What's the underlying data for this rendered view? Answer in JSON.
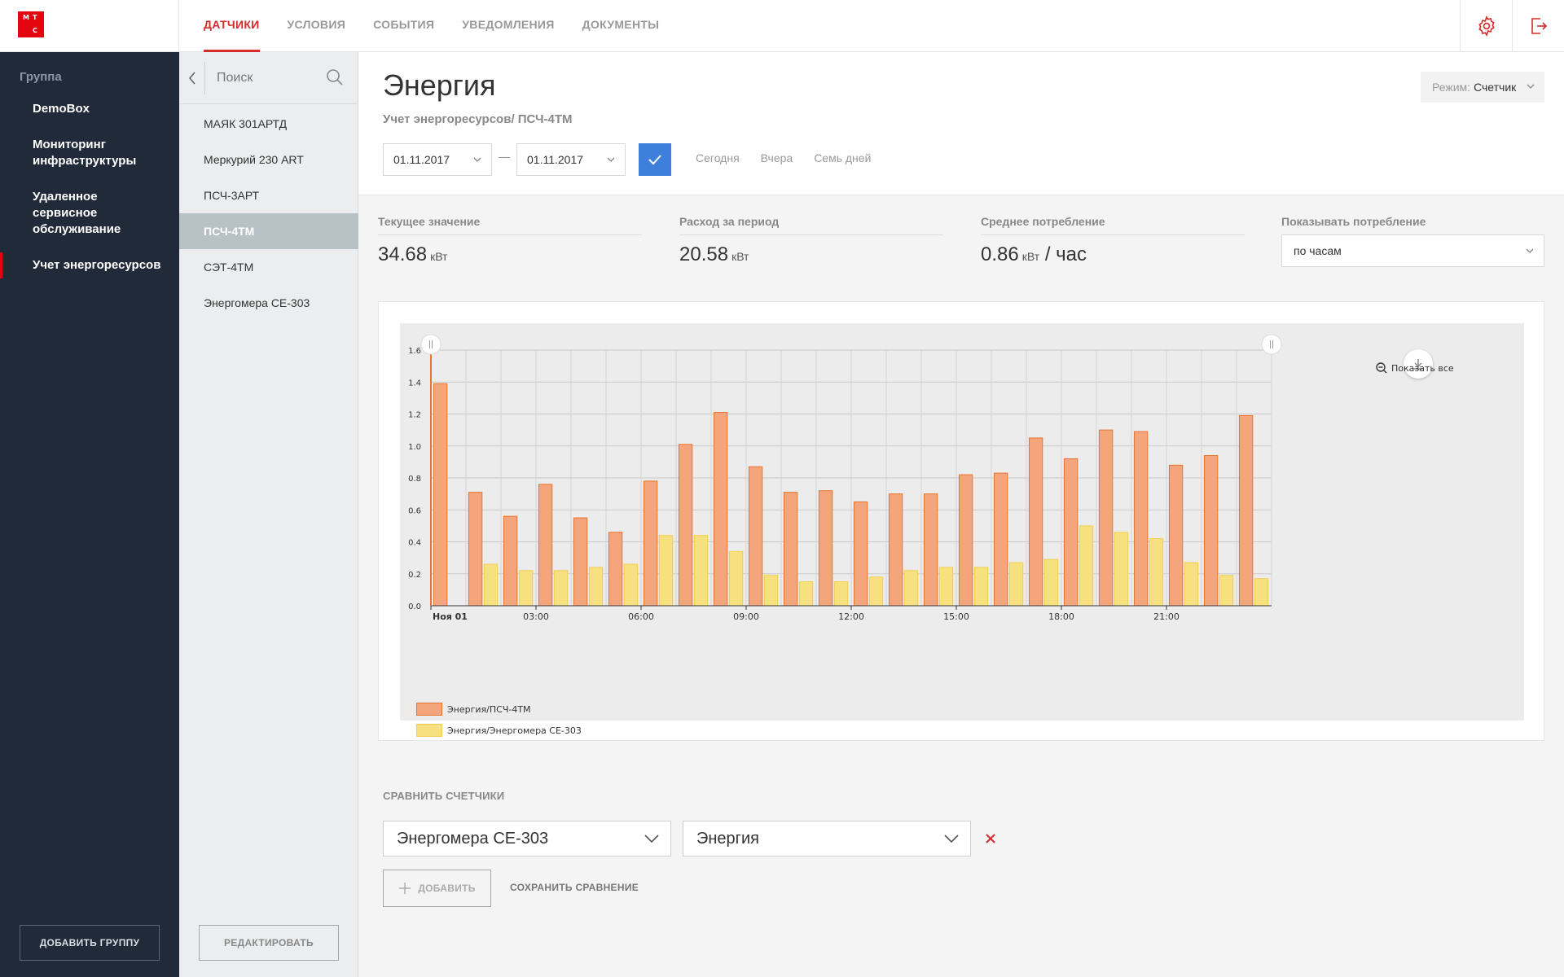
{
  "app": {
    "logo_letters": [
      "М",
      "Т",
      "С"
    ],
    "brand_color": "#e30611"
  },
  "nav": {
    "tabs": [
      {
        "label": "ДАТЧИКИ",
        "active": true
      },
      {
        "label": "УСЛОВИЯ",
        "active": false
      },
      {
        "label": "СОБЫТИЯ",
        "active": false
      },
      {
        "label": "УВЕДОМЛЕНИЯ",
        "active": false
      },
      {
        "label": "ДОКУМЕНТЫ",
        "active": false
      }
    ],
    "icons": [
      "gear-icon",
      "logout-icon"
    ]
  },
  "sidebar": {
    "group_label": "Группа",
    "items": [
      {
        "label": "DemoBox",
        "active": false
      },
      {
        "label": "Мониторинг инфраструктуры",
        "active": false
      },
      {
        "label": "Удаленное сервисное обслуживание",
        "active": false
      },
      {
        "label": "Учет энергоресурсов",
        "active": true
      }
    ],
    "add_group_label": "ДОБАВИТЬ ГРУППУ"
  },
  "sensors": {
    "search_placeholder": "Поиск",
    "items": [
      {
        "label": "МАЯК 301АРТД",
        "active": false
      },
      {
        "label": "Меркурий 230 ART",
        "active": false
      },
      {
        "label": "ПСЧ-3АРТ",
        "active": false
      },
      {
        "label": "ПСЧ-4ТМ",
        "active": true
      },
      {
        "label": "СЭТ-4ТМ",
        "active": false
      },
      {
        "label": "Энергомера СЕ-303",
        "active": false
      }
    ],
    "edit_label": "РЕДАКТИРОВАТЬ"
  },
  "main": {
    "title": "Энергия",
    "subtitle": "Учет энергоресурсов/ ПСЧ-4ТМ",
    "mode": {
      "prefix": "Режим:",
      "value": "Счетчик"
    },
    "date_from": "01.11.2017",
    "date_to": "01.11.2017",
    "date_separator": "—",
    "quick_ranges": [
      "Сегодня",
      "Вчера",
      "Семь дней"
    ],
    "stats": [
      {
        "label": "Текущее значение",
        "value": "34.68",
        "unit": "кВт",
        "suffix": ""
      },
      {
        "label": "Расход за период",
        "value": "20.58",
        "unit": "кВт",
        "suffix": ""
      },
      {
        "label": "Среднее потребление",
        "value": "0.86",
        "unit": "кВт",
        "suffix": "/ час"
      }
    ],
    "consumption": {
      "label": "Показывать потребление",
      "value": "по часам"
    },
    "compare": {
      "label": "СРАВНИТЬ СЧЕТЧИКИ",
      "meter": "Энергомера СЕ-303",
      "metric": "Энергия",
      "add_label": "ДОБАВИТЬ",
      "save_label": "СОХРАНИТЬ СРАВНЕНИЕ"
    }
  },
  "chart_data": {
    "type": "bar",
    "title": "",
    "xlabel": "",
    "ylabel": "",
    "ylim": [
      0,
      1.6
    ],
    "yticks": [
      "0.0",
      "0.2",
      "0.4",
      "0.6",
      "0.8",
      "1.0",
      "1.2",
      "1.4",
      "1.6"
    ],
    "x_tick_labels": [
      {
        "hour": 0,
        "label": "Ноя 01",
        "bold": true
      },
      {
        "hour": 3,
        "label": "03:00",
        "bold": false
      },
      {
        "hour": 6,
        "label": "06:00",
        "bold": false
      },
      {
        "hour": 9,
        "label": "09:00",
        "bold": false
      },
      {
        "hour": 12,
        "label": "12:00",
        "bold": false
      },
      {
        "hour": 15,
        "label": "15:00",
        "bold": false
      },
      {
        "hour": 18,
        "label": "18:00",
        "bold": false
      },
      {
        "hour": 21,
        "label": "21:00",
        "bold": false
      }
    ],
    "hours": [
      0,
      1,
      2,
      3,
      4,
      5,
      6,
      7,
      8,
      9,
      10,
      11,
      12,
      13,
      14,
      15,
      16,
      17,
      18,
      19,
      20,
      21,
      22,
      23
    ],
    "grid": true,
    "legend_position": "bottom-left",
    "show_all_label": "Показать все",
    "series": [
      {
        "name": "Энергия/ПСЧ-4ТМ",
        "color": "#f4a57b",
        "stroke": "#e8742f",
        "values": [
          1.39,
          0.71,
          0.56,
          0.76,
          0.55,
          0.46,
          0.78,
          1.01,
          1.21,
          0.87,
          0.71,
          0.72,
          0.65,
          0.7,
          0.7,
          0.82,
          0.83,
          1.05,
          0.92,
          1.1,
          1.09,
          0.88,
          0.94,
          1.19
        ]
      },
      {
        "name": "Энергия/Энергомера СЕ-303",
        "color": "#f7e07f",
        "stroke": "#f0cf52",
        "values": [
          0,
          0.26,
          0.22,
          0.22,
          0.24,
          0.26,
          0.44,
          0.44,
          0.34,
          0.19,
          0.15,
          0.15,
          0.18,
          0.22,
          0.24,
          0.24,
          0.27,
          0.29,
          0.5,
          0.46,
          0.42,
          0.27,
          0.19,
          0.17
        ]
      }
    ]
  }
}
